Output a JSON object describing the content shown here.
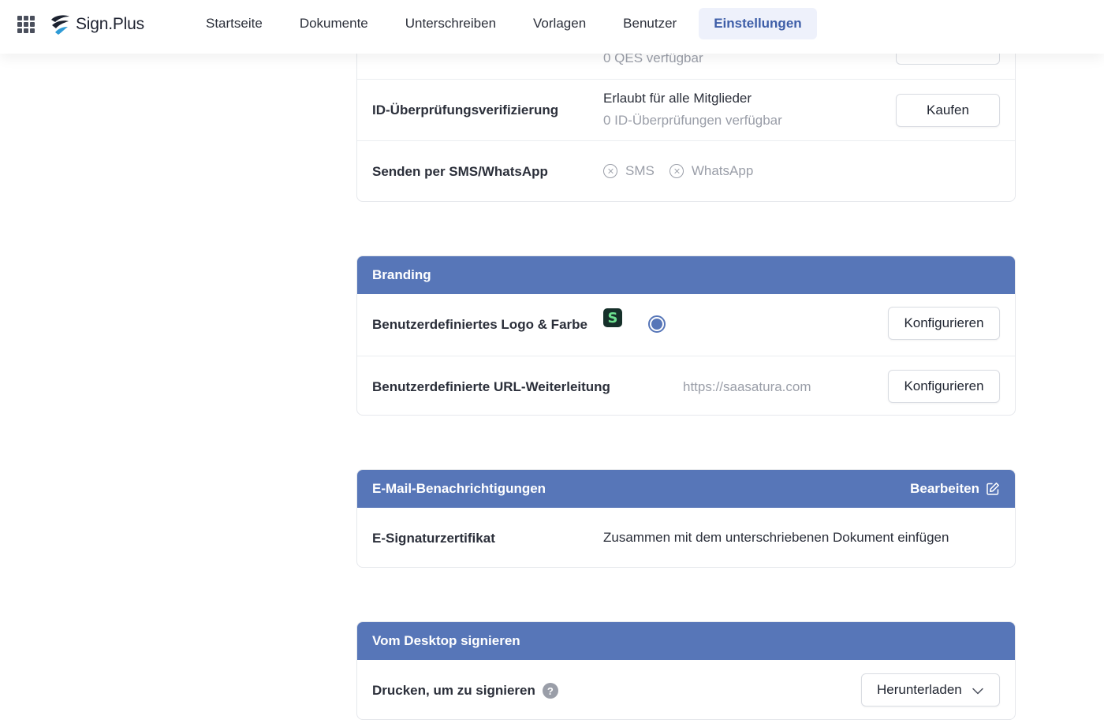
{
  "app": {
    "name": "Sign.Plus"
  },
  "nav": {
    "items": [
      {
        "label": "Startseite"
      },
      {
        "label": "Dokumente"
      },
      {
        "label": "Unterschreiben"
      },
      {
        "label": "Vorlagen"
      },
      {
        "label": "Benutzer"
      },
      {
        "label": "Einstellungen",
        "active": true
      }
    ]
  },
  "security": {
    "qes_available": "0 QES verfügbar",
    "id_verification": {
      "label": "ID-Überprüfungsverifizierung",
      "allowed": "Erlaubt für alle Mitglieder",
      "available": "0 ID-Überprüfungen verfügbar",
      "button": "Kaufen"
    },
    "sms_whatsapp": {
      "label": "Senden per SMS/WhatsApp",
      "sms": "SMS",
      "whatsapp": "WhatsApp"
    }
  },
  "branding": {
    "title": "Branding",
    "logo_color": {
      "label": "Benutzerdefiniertes Logo & Farbe",
      "logo_letter": "S",
      "color": "#5776b8",
      "button": "Konfigurieren"
    },
    "url_redirect": {
      "label": "Benutzerdefinierte URL-Weiterleitung",
      "url": "https://saasatura.com",
      "button": "Konfigurieren"
    }
  },
  "email": {
    "title": "E-Mail-Benachrichtigungen",
    "edit": "Bearbeiten",
    "certificate": {
      "label": "E-Signaturzertifikat",
      "value": "Zusammen mit dem unterschriebenen Dokument einfügen"
    }
  },
  "desktop": {
    "title": "Vom Desktop signieren",
    "print": {
      "label": "Drucken, um zu signieren",
      "help": "?",
      "button": "Herunterladen"
    }
  },
  "colors": {
    "header_blue": "#5776b8",
    "nav_active_text": "#3e5ea8",
    "nav_active_bg": "#eef1fb"
  }
}
